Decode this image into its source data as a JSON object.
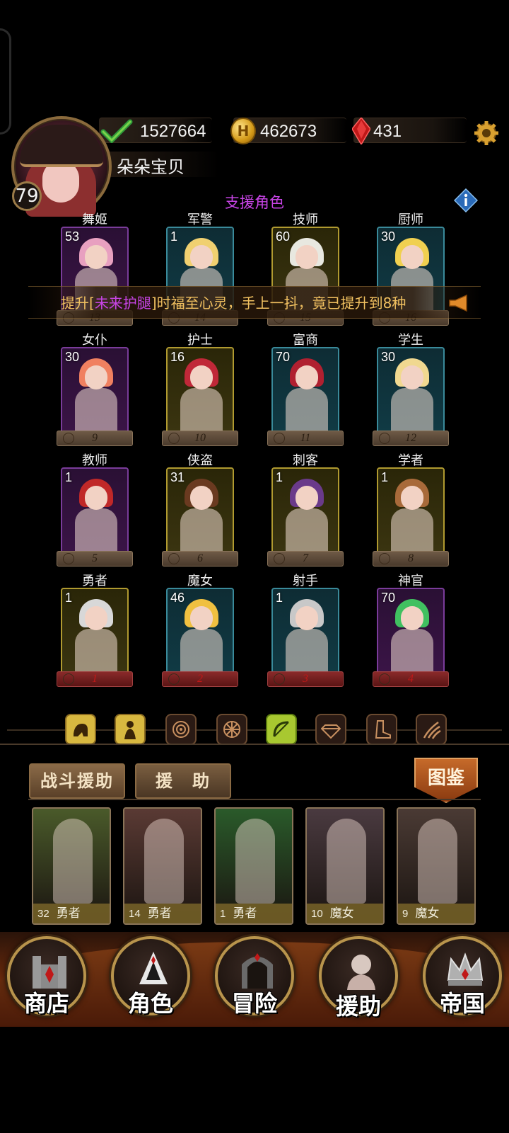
{
  "header": {
    "player_level": "79",
    "player_name": "朵朵宝贝",
    "resources": [
      {
        "icon": "check-icon",
        "value": "1527664"
      },
      {
        "icon": "gold-coin-icon",
        "value": "462673",
        "coin_letter": "H"
      },
      {
        "icon": "red-gem-icon",
        "value": "431"
      }
    ],
    "settings_icon": "gear-icon"
  },
  "section_title": "支援角色",
  "info_icon": "info-icon",
  "marquee": {
    "prefix": "提升[",
    "highlight": "未来护腿",
    "suffix": "]时福至心灵，手上一抖，竟已提升到8种"
  },
  "characters": [
    {
      "name": "舞姬",
      "level": "53",
      "rank": "13",
      "frame": "purple"
    },
    {
      "name": "军警",
      "level": "1",
      "rank": "14",
      "frame": "teal"
    },
    {
      "name": "技师",
      "level": "60",
      "rank": "15",
      "frame": "gold"
    },
    {
      "name": "厨师",
      "level": "30",
      "rank": "16",
      "frame": "teal"
    },
    {
      "name": "女仆",
      "level": "30",
      "rank": "9",
      "frame": "purple"
    },
    {
      "name": "护士",
      "level": "16",
      "rank": "10",
      "frame": "gold"
    },
    {
      "name": "富商",
      "level": "70",
      "rank": "11",
      "frame": "teal"
    },
    {
      "name": "学生",
      "level": "30",
      "rank": "12",
      "frame": "teal"
    },
    {
      "name": "教师",
      "level": "1",
      "rank": "5",
      "frame": "purple"
    },
    {
      "name": "侠盗",
      "level": "31",
      "rank": "6",
      "frame": "gold"
    },
    {
      "name": "刺客",
      "level": "1",
      "rank": "7",
      "frame": "gold"
    },
    {
      "name": "学者",
      "level": "1",
      "rank": "8",
      "frame": "gold"
    },
    {
      "name": "勇者",
      "level": "1",
      "rank": "1",
      "frame": "gold"
    },
    {
      "name": "魔女",
      "level": "46",
      "rank": "2",
      "frame": "teal"
    },
    {
      "name": "射手",
      "level": "1",
      "rank": "3",
      "frame": "teal"
    },
    {
      "name": "神官",
      "level": "70",
      "rank": "4",
      "frame": "purple"
    }
  ],
  "filters": [
    {
      "icon": "lion-icon",
      "state": "active"
    },
    {
      "icon": "silhouette-icon",
      "state": "active"
    },
    {
      "icon": "target-icon",
      "state": "inactive"
    },
    {
      "icon": "wheel-icon",
      "state": "inactive"
    },
    {
      "icon": "bow-icon",
      "state": "active-green"
    },
    {
      "icon": "diamond-icon",
      "state": "inactive"
    },
    {
      "icon": "boot-icon",
      "state": "inactive"
    },
    {
      "icon": "claw-icon",
      "state": "inactive"
    }
  ],
  "tabs": [
    {
      "label": "战斗援助"
    },
    {
      "label": "援　助"
    }
  ],
  "codex_label": "图鉴",
  "support_cards": [
    {
      "level": "32",
      "class": "勇者",
      "color": "#4a5a2a"
    },
    {
      "level": "14",
      "class": "勇者",
      "color": "#5a3a34"
    },
    {
      "level": "1",
      "class": "勇者",
      "color": "#2a5a2a"
    },
    {
      "level": "10",
      "class": "魔女",
      "color": "#4a3a40"
    },
    {
      "level": "9",
      "class": "魔女",
      "color": "#4a3a34"
    }
  ],
  "nav": [
    {
      "label": "商店",
      "icon": "castle-icon"
    },
    {
      "label": "角色",
      "icon": "hood-icon"
    },
    {
      "label": "冒险",
      "icon": "gate-icon"
    },
    {
      "label": "援助",
      "icon": "portrait-icon"
    },
    {
      "label": "帝国",
      "icon": "crown-icon"
    }
  ]
}
